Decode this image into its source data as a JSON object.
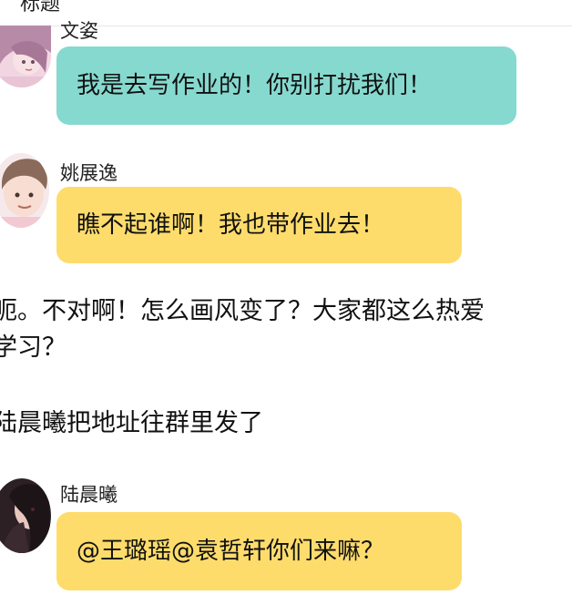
{
  "header": {
    "title": "标题"
  },
  "messages": [
    {
      "sender": "文姿",
      "text": "我是去写作业的！你别打扰我们！",
      "bubble_color": "#86d9cf",
      "avatar": "girl-avatar-pink-hair"
    },
    {
      "sender": "姚展逸",
      "text": "瞧不起谁啊！我也带作业去！",
      "bubble_color": "#fddc6c",
      "avatar": "boy-avatar-brown-hair"
    },
    {
      "sender": "陆晨曦",
      "text": "@王璐瑶@袁哲轩你们来嘛？",
      "bubble_color": "#fddc6c",
      "avatar": "girl-avatar-dark-hair"
    }
  ],
  "narration": {
    "line1": "呃。不对啊！怎么画风变了？大家都这么热爱",
    "line2": "学习？",
    "line3": "陆晨曦把地址往群里发了"
  }
}
